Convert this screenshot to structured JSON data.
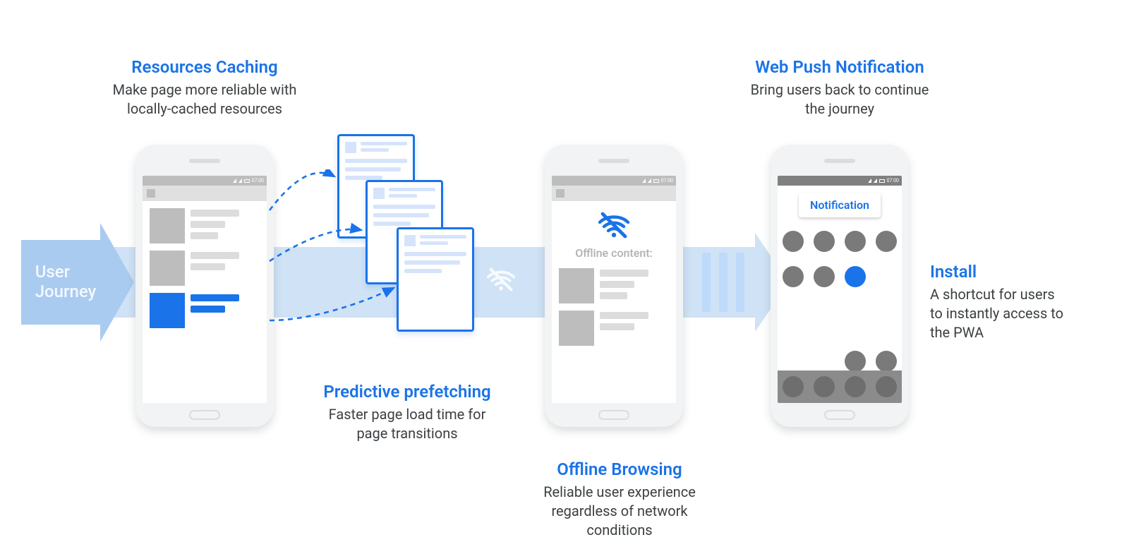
{
  "flow": {
    "start_label": "User\nJourney"
  },
  "captions": {
    "caching": {
      "title": "Resources Caching",
      "sub": "Make page more reliable with\nlocally-cached resources"
    },
    "prefetch": {
      "title": "Predictive prefetching",
      "sub": "Faster page load time for\npage transitions"
    },
    "offline": {
      "title": "Offline Browsing",
      "sub": "Reliable user experience\nregardless of network\nconditions"
    },
    "push": {
      "title": "Web Push Notification",
      "sub": "Bring users back to continue\nthe journey"
    },
    "install": {
      "title": "Install",
      "sub": "A shortcut for users\nto instantly access to\nthe PWA"
    }
  },
  "phones": {
    "offline": {
      "heading": "Offline content:"
    },
    "install": {
      "notification_label": "Notification",
      "status_time": "07:00"
    },
    "status_time": "07:00"
  },
  "icons": {
    "wifi_off": "wifi-off-icon"
  }
}
